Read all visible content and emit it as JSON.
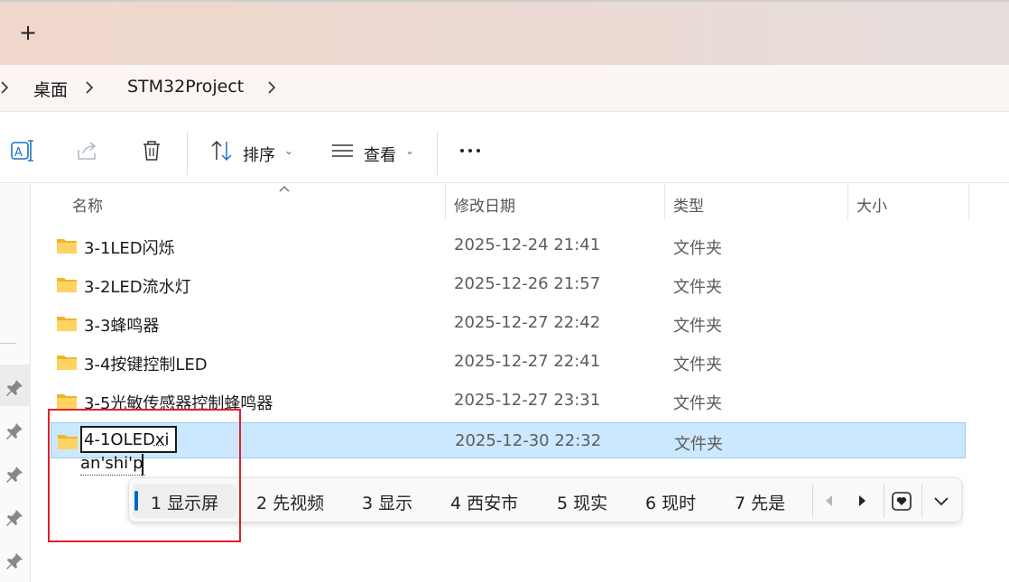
{
  "titlebar": {
    "new_tab_icon": "plus-icon",
    "new_tab_label": "+"
  },
  "breadcrumb": {
    "items": [
      "桌面",
      "STM32Project"
    ]
  },
  "toolbar": {
    "sort_label": "排序",
    "view_label": "查看",
    "icons": [
      "rename-icon",
      "share-icon",
      "delete-icon",
      "sort-icon",
      "view-icon",
      "more-icon"
    ]
  },
  "columns": {
    "name": "名称",
    "date": "修改日期",
    "type": "类型",
    "size": "大小"
  },
  "rows": [
    {
      "name": "3-1LED闪烁",
      "date": "2025-12-24 21:41",
      "type": "文件夹"
    },
    {
      "name": "3-2LED流水灯",
      "date": "2025-12-26 21:57",
      "type": "文件夹"
    },
    {
      "name": "3-3蜂鸣器",
      "date": "2025-12-27 22:42",
      "type": "文件夹"
    },
    {
      "name": "3-4按键控制LED",
      "date": "2025-12-27 22:41",
      "type": "文件夹"
    },
    {
      "name": "3-5光敏传感器控制蜂鸣器",
      "date": "2025-12-27 23:31",
      "type": "文件夹"
    }
  ],
  "editing_row": {
    "name_value": "4-1OLEDxi",
    "composition": "an'shi'p",
    "date": "2025-12-30 22:32",
    "type": "文件夹"
  },
  "ime": {
    "candidates": [
      "1 显示屏",
      "2 先视频",
      "3 显示",
      "4 西安市",
      "5 现实",
      "6 现时",
      "7 先是"
    ],
    "selected_index": 0,
    "accent_color": "#0067c0"
  },
  "annotation": {
    "box_color": "#e0202a"
  }
}
